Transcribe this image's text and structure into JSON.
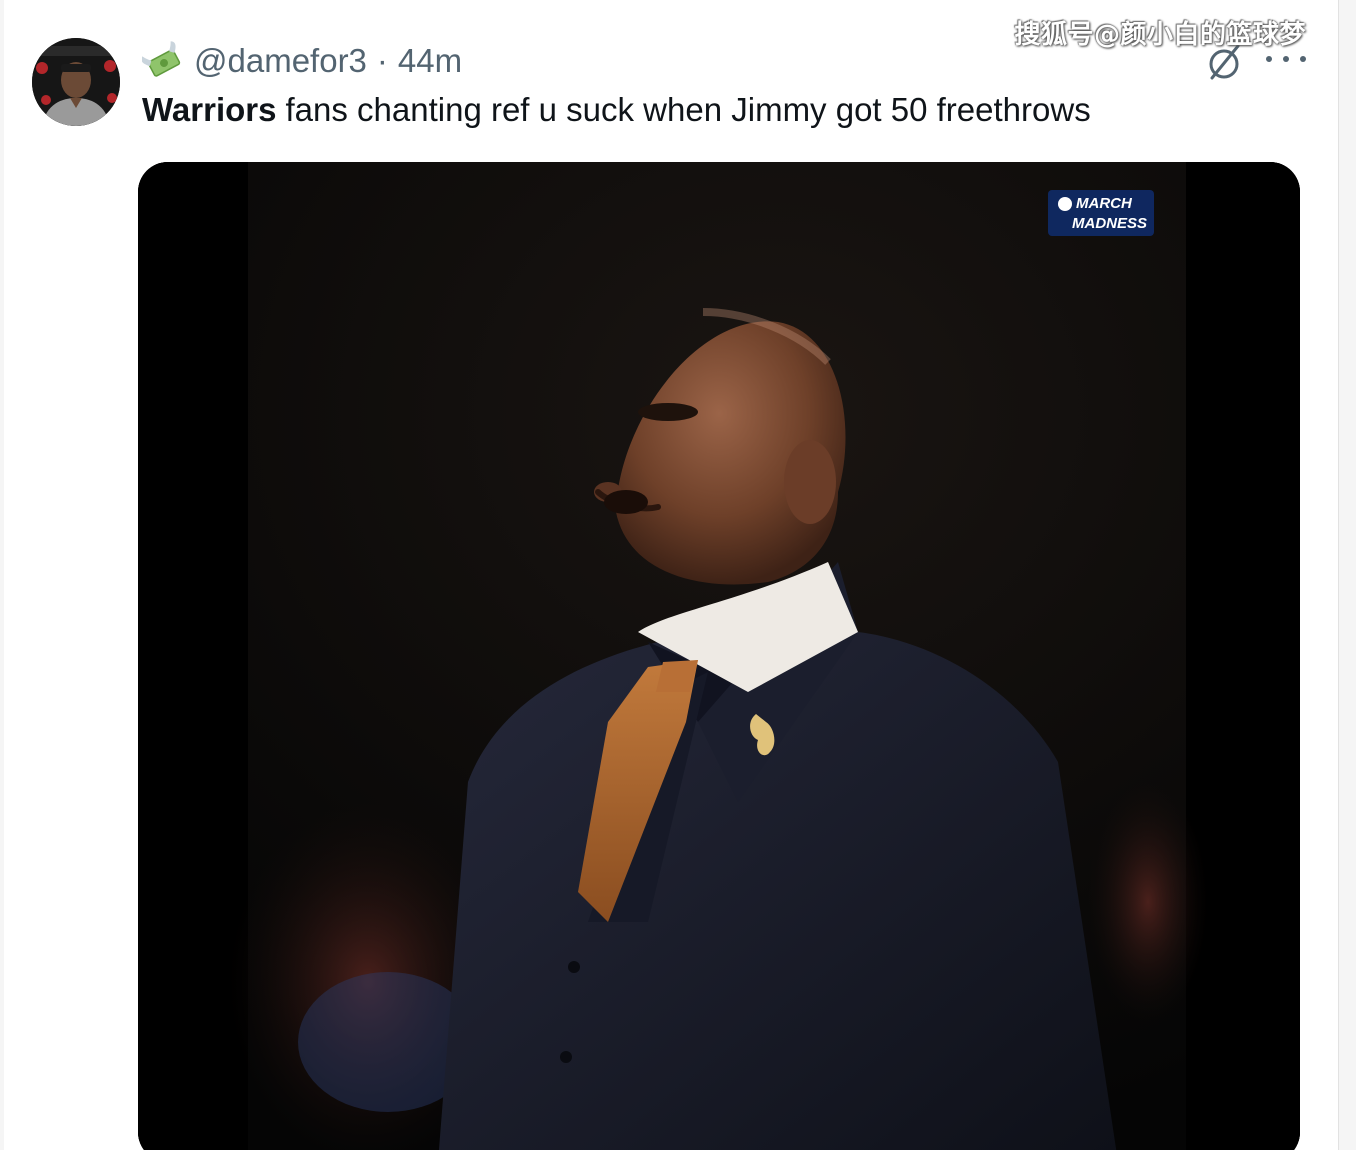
{
  "watermark": {
    "text": "搜狐号@颜小白的篮球梦"
  },
  "tweet": {
    "avatar_icon": "user-avatar",
    "emoji_icon": "money-with-wings-icon",
    "handle": "@damefor3",
    "separator": "·",
    "time": "44m",
    "text_strong": "Warriors",
    "text_rest": "fans chanting ref u suck when Jimmy got 50 freethrows",
    "actions": {
      "grok_icon": "grok-icon",
      "more_icon": "more-options-icon"
    }
  },
  "media": {
    "description_icon": "photo",
    "badge_line1": "MARCH",
    "badge_line2": "MADNESS"
  },
  "colors": {
    "text_primary": "#0f1419",
    "text_secondary": "#536471",
    "background": "#ffffff"
  }
}
